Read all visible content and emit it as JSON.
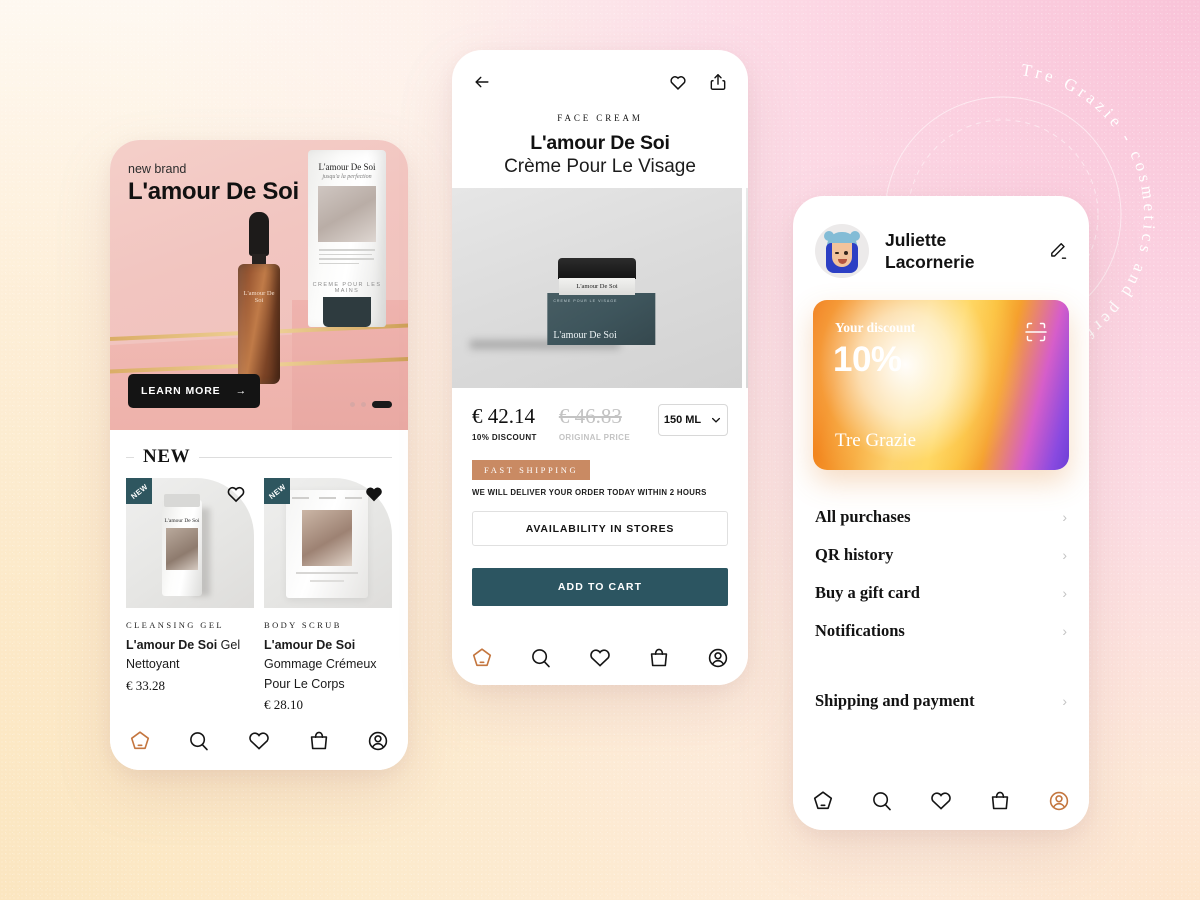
{
  "background": {
    "badge_text": "Tre Grazie - cosmetics and perfume shop",
    "accent_pink": "#f9c3d8",
    "accent_cream": "#fbe6c0"
  },
  "left_phone": {
    "hero": {
      "eyebrow": "new brand",
      "title": "L'amour De Soi",
      "cta_label": "LEARN MORE",
      "cta_arrow": "→",
      "tube_brand": "L'amour De Soi",
      "tube_script": "jusqu'a la perfection",
      "tube_footer": "CREME POUR LES MAINS",
      "dropper_label": "L'amour De Soi",
      "dots": [
        "inactive",
        "inactive",
        "active"
      ]
    },
    "section_title": "NEW",
    "products": [
      {
        "badge": "NEW",
        "category": "CLEANSING GEL",
        "name_bold": "L'amour De Soi",
        "name_rest": " Gel Nettoyant",
        "price": "€ 33.28",
        "bottle_label": "L'amour De Soi",
        "favorited": false
      },
      {
        "badge": "NEW",
        "category": "BODY SCRUB",
        "name_bold": "L'amour De Soi",
        "name_rest": " Gommage Crémeux Pour Le Corps",
        "price": "€ 28.10",
        "favorited": true
      }
    ],
    "nav": [
      {
        "icon": "home-icon",
        "active": true
      },
      {
        "icon": "search-icon",
        "active": false
      },
      {
        "icon": "heart-icon",
        "active": false
      },
      {
        "icon": "bag-icon",
        "active": false
      },
      {
        "icon": "profile-icon",
        "active": false
      }
    ]
  },
  "mid_phone": {
    "back_icon": "back-arrow-icon",
    "heart_icon": "heart-icon",
    "share_icon": "share-icon",
    "category": "FACE CREAM",
    "title": "L'amour De Soi",
    "subtitle": "Crème Pour Le Visage",
    "gallery": {
      "jar_label": "L'amour De Soi",
      "box_top_text": "CREME POUR LE VISAGE",
      "box_brand": "L'amour De Soi"
    },
    "price_new": "€ 42.14",
    "price_new_sub": "10% DISCOUNT",
    "price_old": "€ 46.83",
    "price_old_sub": "ORIGINAL PRICE",
    "size_value": "150 ML",
    "size_chevron": "⌄",
    "shipping_badge": "FAST SHIPPING",
    "shipping_note": "WE WILL DELIVER YOUR ORDER TODAY WITHIN 2 HOURS",
    "availability_label": "AVAILABILITY IN STORES",
    "add_to_cart_label": "ADD TO CART",
    "add_to_cart_color": "#2c5561",
    "nav": [
      {
        "icon": "home-icon",
        "active": true
      },
      {
        "icon": "search-icon",
        "active": false
      },
      {
        "icon": "heart-icon",
        "active": false
      },
      {
        "icon": "bag-icon",
        "active": false
      },
      {
        "icon": "profile-icon",
        "active": false
      }
    ]
  },
  "right_phone": {
    "user_name": "Juliette\nLacornerie",
    "user_first": "Juliette",
    "user_last": "Lacornerie",
    "edit_icon": "pencil-edit-icon",
    "discount_card": {
      "label": "Your discount",
      "percent": "10%",
      "brand": "Tre Grazie",
      "qr_icon": "qr-scan-icon"
    },
    "menu": [
      {
        "label": "All purchases",
        "chevron": "›"
      },
      {
        "label": "QR history",
        "chevron": "›"
      },
      {
        "label": "Buy a gift card",
        "chevron": "›"
      },
      {
        "label": "Notifications",
        "chevron": "›"
      }
    ],
    "menu_secondary": [
      {
        "label": "Shipping and payment",
        "chevron": "›"
      }
    ],
    "nav": [
      {
        "icon": "home-icon",
        "active": false
      },
      {
        "icon": "search-icon",
        "active": false
      },
      {
        "icon": "heart-icon",
        "active": false
      },
      {
        "icon": "bag-icon",
        "active": false
      },
      {
        "icon": "profile-icon",
        "active": true
      }
    ]
  }
}
